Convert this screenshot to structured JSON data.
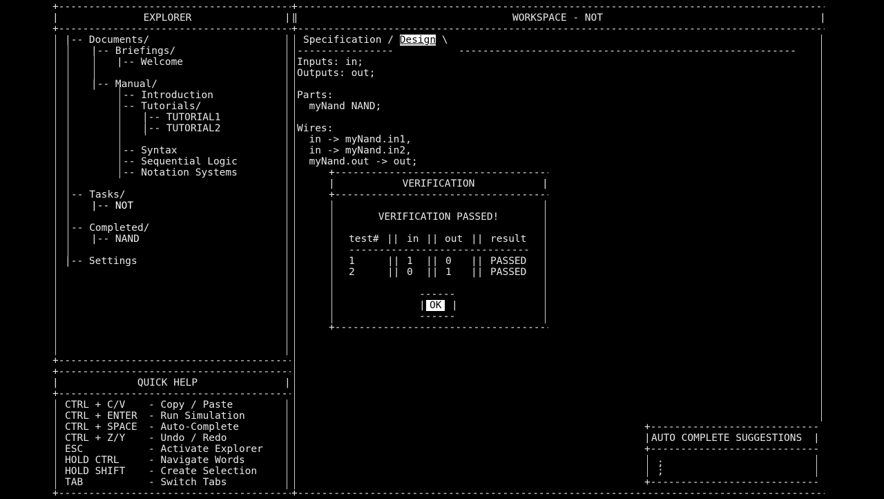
{
  "explorer": {
    "title": "EXPLORER",
    "tree": [
      {
        "text": "|-- Documents/",
        "indent": 0
      },
      {
        "text": "|-- Briefings/",
        "indent": 1
      },
      {
        "text": "|-- Welcome",
        "indent": 2
      },
      {
        "text": "|-- Manual/",
        "indent": 1
      },
      {
        "text": "-- Introduction",
        "indent": 2
      },
      {
        "text": "-- Tutorials/",
        "indent": 2
      },
      {
        "text": "|-- TUTORIAL1",
        "indent": 3
      },
      {
        "text": "|-- TUTORIAL2",
        "indent": 3
      },
      {
        "text": "-- Syntax",
        "indent": 2
      },
      {
        "text": "-- Sequential Logic",
        "indent": 2
      },
      {
        "text": "-- Notation Systems",
        "indent": 2
      },
      {
        "text": "-- Tasks/",
        "indent": 0
      },
      {
        "text": "|-- NOT",
        "indent": 1
      },
      {
        "text": "-- Completed/",
        "indent": 0
      },
      {
        "text": "|-- NAND",
        "indent": 1
      },
      {
        "text": "|-- Settings",
        "indent": 0
      }
    ]
  },
  "quick_help": {
    "title": "QUICK HELP",
    "rows": [
      {
        "keys": "CTRL + C/V",
        "action": "- Copy / Paste"
      },
      {
        "keys": "CTRL + ENTER",
        "action": "- Run Simulation"
      },
      {
        "keys": "CTRL + SPACE",
        "action": "- Auto-Complete"
      },
      {
        "keys": "CTRL + Z/Y",
        "action": "- Undo / Redo"
      },
      {
        "keys": "ESC",
        "action": "- Activate Explorer"
      },
      {
        "keys": "HOLD CTRL",
        "action": "- Navigate Words"
      },
      {
        "keys": "HOLD SHIFT",
        "action": "- Create Selection"
      },
      {
        "keys": "TAB",
        "action": "- Switch Tabs"
      }
    ]
  },
  "workspace": {
    "title": "WORKSPACE - NOT",
    "tabs": {
      "specification": "Specification",
      "separator": "/",
      "design": "Design",
      "end": "\\"
    },
    "code": [
      "Inputs: in;",
      "Outputs: out;",
      "",
      "Parts:",
      "  myNand NAND;",
      "",
      "Wires:",
      "  in -> myNand.in1,",
      "  in -> myNand.in2,",
      "  myNand.out -> out;"
    ]
  },
  "verification": {
    "title": "VERIFICATION",
    "message": "VERIFICATION PASSED!",
    "columns": [
      "test#",
      "in",
      "out",
      "result"
    ],
    "rows": [
      [
        "1",
        "1",
        "0",
        "PASSED"
      ],
      [
        "2",
        "0",
        "1",
        "PASSED"
      ]
    ],
    "ok_label": "OK"
  },
  "autocomplete": {
    "title": "AUTO COMPLETE SUGGESTIONS",
    "items": [
      ";",
      ";"
    ]
  }
}
